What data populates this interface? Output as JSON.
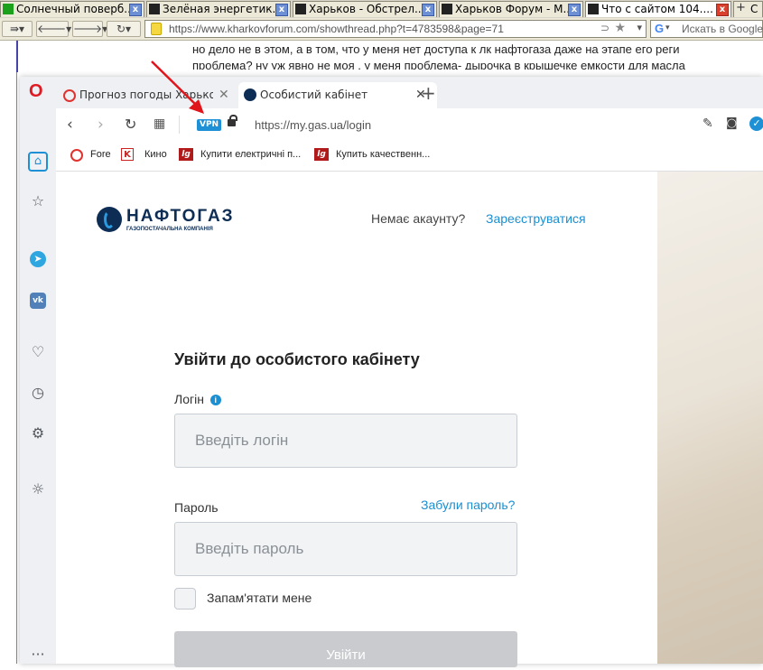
{
  "outer_browser": {
    "tabs": [
      {
        "title": "Солнечный поверб..."
      },
      {
        "title": "Зелёная энергетик..."
      },
      {
        "title": "Харьков - Обстрел..."
      },
      {
        "title": "Харьков Форум - M..."
      },
      {
        "title": "Что с сайтом 104...."
      },
      {
        "title": "С"
      }
    ],
    "url": "https://www.kharkovforum.com/showthread.php?t=4783598&page=71",
    "url_domain": "kharkovforum.com",
    "search_placeholder": "Искать в Google"
  },
  "forum": {
    "line1": "но дело не в этом, а в том, что у меня нет доступа к лк нафтогаза даже на этапе его реги",
    "line2": "проблема? ну уж явно не моя , у меня проблема- дырочка в крышечке емкости для масла"
  },
  "opera": {
    "tabs": [
      {
        "title": "Прогноз погоды Харьков - П"
      },
      {
        "title": "Особистий кабінет"
      }
    ],
    "new_tab": "+",
    "vpn_badge": "VPN",
    "url": "https://my.gas.ua/login",
    "bookmarks": [
      {
        "label": "Fore"
      },
      {
        "label": "Кино"
      },
      {
        "label": "Купити електричні п..."
      },
      {
        "label": "Купить качественн..."
      }
    ]
  },
  "page": {
    "logo_main": "НАФТОГАЗ",
    "logo_sub": "ГАЗОПОСТАЧАЛЬНА КОМПАНІЯ",
    "no_account": "Немає акаунту?",
    "register_link": "Зареєструватися",
    "form_title": "Увійти до особистого кабінету",
    "login_label": "Логін",
    "login_placeholder": "Введіть логін",
    "password_label": "Пароль",
    "forgot_link": "Забули пароль?",
    "password_placeholder": "Введіть пароль",
    "remember_label": "Запам'ятати мене",
    "submit_label": "Увійти"
  },
  "colors": {
    "accent_link": "#1a8fd1",
    "annotation_arrow": "#e0141b",
    "vpn_badge": "#1e90d6"
  }
}
